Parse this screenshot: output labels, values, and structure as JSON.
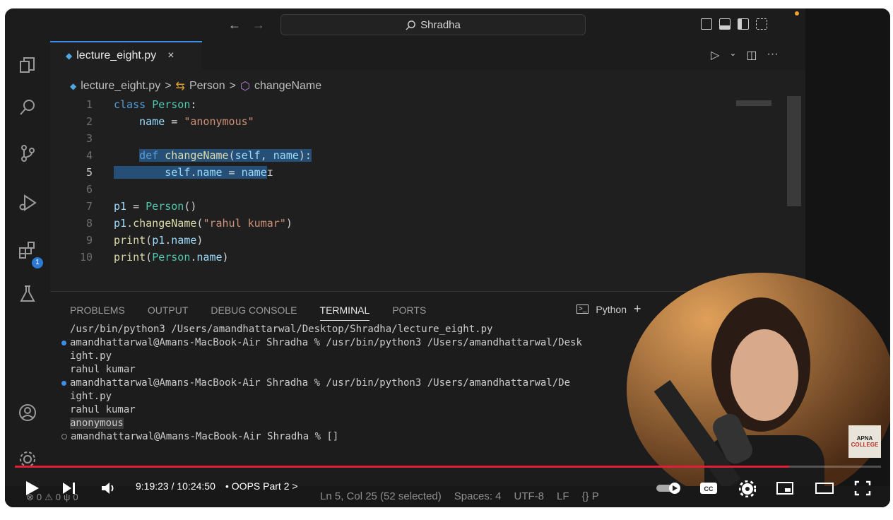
{
  "titlebar": {
    "back": "←",
    "forward": "→",
    "search_text": "Shradha"
  },
  "tab": {
    "filename": "lecture_eight.py",
    "close": "×"
  },
  "tab_actions": {
    "run": "▷",
    "run_menu": "⌄",
    "split": "◫",
    "more": "···"
  },
  "breadcrumb": {
    "file": "lecture_eight.py",
    "sep": ">",
    "class": "Person",
    "method": "changeName"
  },
  "activity": {
    "extensions_badge": "1"
  },
  "code": {
    "lines": [
      {
        "n": "1"
      },
      {
        "n": "2"
      },
      {
        "n": "3"
      },
      {
        "n": "4"
      },
      {
        "n": "5"
      },
      {
        "n": "6"
      },
      {
        "n": "7"
      },
      {
        "n": "8"
      },
      {
        "n": "9"
      },
      {
        "n": "10"
      }
    ]
  },
  "panel": {
    "tabs": [
      "PROBLEMS",
      "OUTPUT",
      "DEBUG CONSOLE",
      "TERMINAL",
      "PORTS"
    ],
    "active_tab": "TERMINAL",
    "shell": "Python",
    "add": "+",
    "terminal": [
      "/usr/bin/python3 /Users/amandhattarwal/Desktop/Shradha/lecture_eight.py",
      "amandhattarwal@Amans-MacBook-Air Shradha % /usr/bin/python3 /Users/amandhattarwal/Desk",
      "ight.py",
      "rahul kumar",
      "amandhattarwal@Amans-MacBook-Air Shradha % /usr/bin/python3 /Users/amandhattarwal/De",
      "ight.py",
      "rahul kumar",
      "anonymous",
      "amandhattarwal@Amans-MacBook-Air Shradha % []"
    ]
  },
  "statusbar": {
    "errors": "0",
    "warnings": "0",
    "ports": "0",
    "position": "Ln 5, Col 25 (52 selected)",
    "spaces": "Spaces: 4",
    "encoding": "UTF-8",
    "eol": "LF",
    "lang": "{} P"
  },
  "watermark": {
    "line1": "APNA",
    "line2": "COLLEGE"
  },
  "player": {
    "time": "9:19:23 / 10:24:50",
    "chapter": "• OOPS Part 2 >",
    "progress_fraction": 0.894,
    "icons": [
      "play-icon",
      "next-icon",
      "volume-icon",
      "autoplay-toggle",
      "cc-icon",
      "settings-icon",
      "miniplayer-icon",
      "theater-icon",
      "fullscreen-icon"
    ]
  }
}
